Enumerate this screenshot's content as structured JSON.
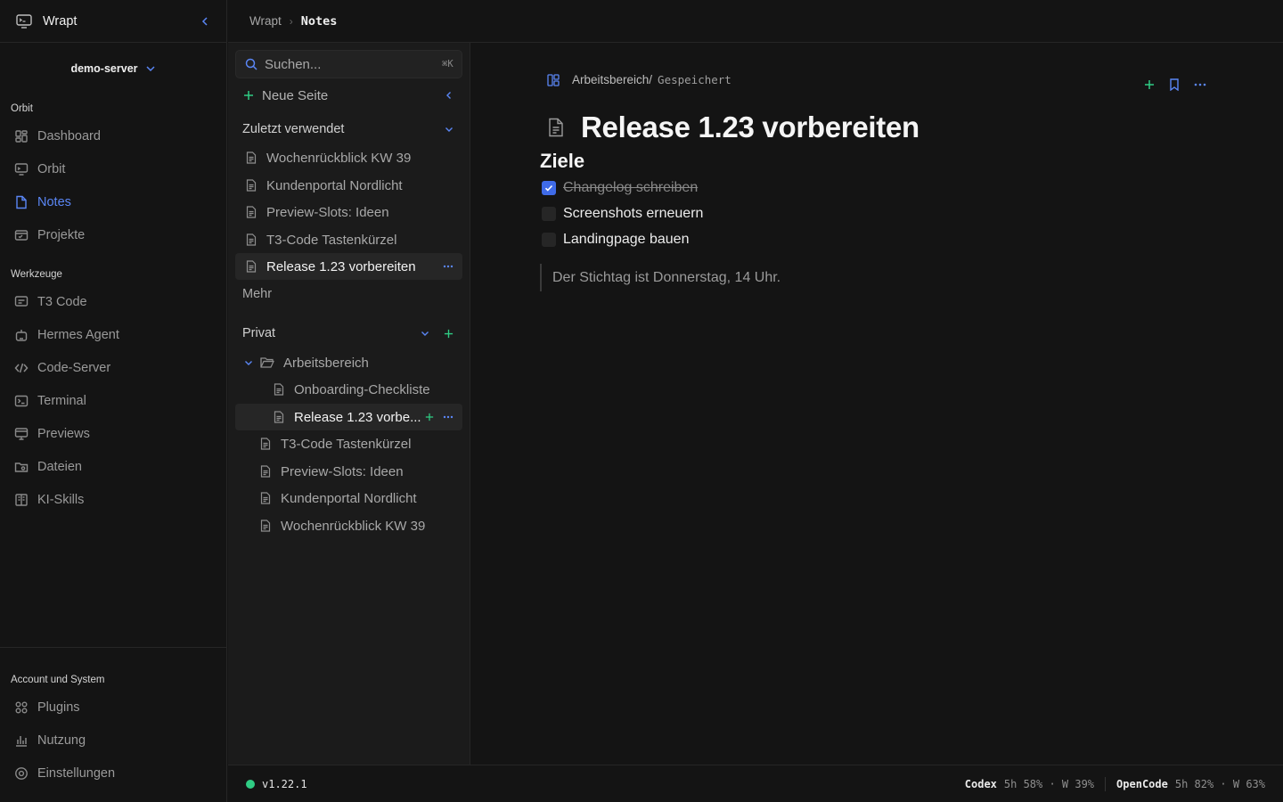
{
  "app": {
    "title": "Wrapt",
    "server": "demo-server"
  },
  "sidebar": {
    "sections": [
      {
        "title": "Orbit",
        "items": [
          {
            "label": "Dashboard",
            "icon": "dashboard-icon"
          },
          {
            "label": "Orbit",
            "icon": "monitor-icon"
          },
          {
            "label": "Notes",
            "icon": "note-icon",
            "active": true
          },
          {
            "label": "Projekte",
            "icon": "projects-icon"
          }
        ]
      },
      {
        "title": "Werkzeuge",
        "items": [
          {
            "label": "T3 Code",
            "icon": "chat-icon"
          },
          {
            "label": "Hermes Agent",
            "icon": "robot-icon"
          },
          {
            "label": "Code-Server",
            "icon": "code-icon"
          },
          {
            "label": "Terminal",
            "icon": "terminal-icon"
          },
          {
            "label": "Previews",
            "icon": "preview-icon"
          },
          {
            "label": "Dateien",
            "icon": "files-icon"
          },
          {
            "label": "KI-Skills",
            "icon": "book-icon"
          }
        ]
      }
    ],
    "bottom": {
      "title": "Account und System",
      "items": [
        {
          "label": "Plugins",
          "icon": "plugins-icon"
        },
        {
          "label": "Nutzung",
          "icon": "chart-icon"
        },
        {
          "label": "Einstellungen",
          "icon": "settings-icon"
        }
      ]
    }
  },
  "topbar": {
    "crumb1": "Wrapt",
    "crumb2": "Notes"
  },
  "notes": {
    "search_placeholder": "Suchen...",
    "search_shortcut": "⌘K",
    "new_page": "Neue Seite",
    "recent_title": "Zuletzt verwendet",
    "recent": [
      "Wochenrückblick KW 39",
      "Kundenportal Nordlicht",
      "Preview-Slots: Ideen",
      "T3-Code Tastenkürzel",
      "Release 1.23 vorbereiten"
    ],
    "more": "Mehr",
    "private_title": "Privat",
    "folder": "Arbeitsbereich",
    "folder_pages": [
      "Onboarding-Checkliste",
      "Release 1.23 vorbe..."
    ],
    "private_pages": [
      "T3-Code Tastenkürzel",
      "Preview-Slots: Ideen",
      "Kundenportal Nordlicht",
      "Wochenrückblick KW 39"
    ]
  },
  "editor": {
    "crumb_folder": "Arbeitsbereich/",
    "crumb_status": "Gespeichert",
    "title": "Release 1.23 vorbereiten",
    "heading": "Ziele",
    "todos": [
      {
        "text": "Changelog schreiben",
        "checked": true
      },
      {
        "text": "Screenshots erneuern",
        "checked": false
      },
      {
        "text": "Landingpage bauen",
        "checked": false
      }
    ],
    "quote": "Der Stichtag ist Donnerstag, 14 Uhr."
  },
  "status": {
    "version": "v1.22.1",
    "codex_name": "Codex",
    "codex_usage": "5h 58% · W 39%",
    "opencode_name": "OpenCode",
    "opencode_usage": "5h 82% · W 63%"
  },
  "colors": {
    "accent": "#5a86f5",
    "green": "#2fcc84",
    "checkbox": "#3f6be8"
  }
}
